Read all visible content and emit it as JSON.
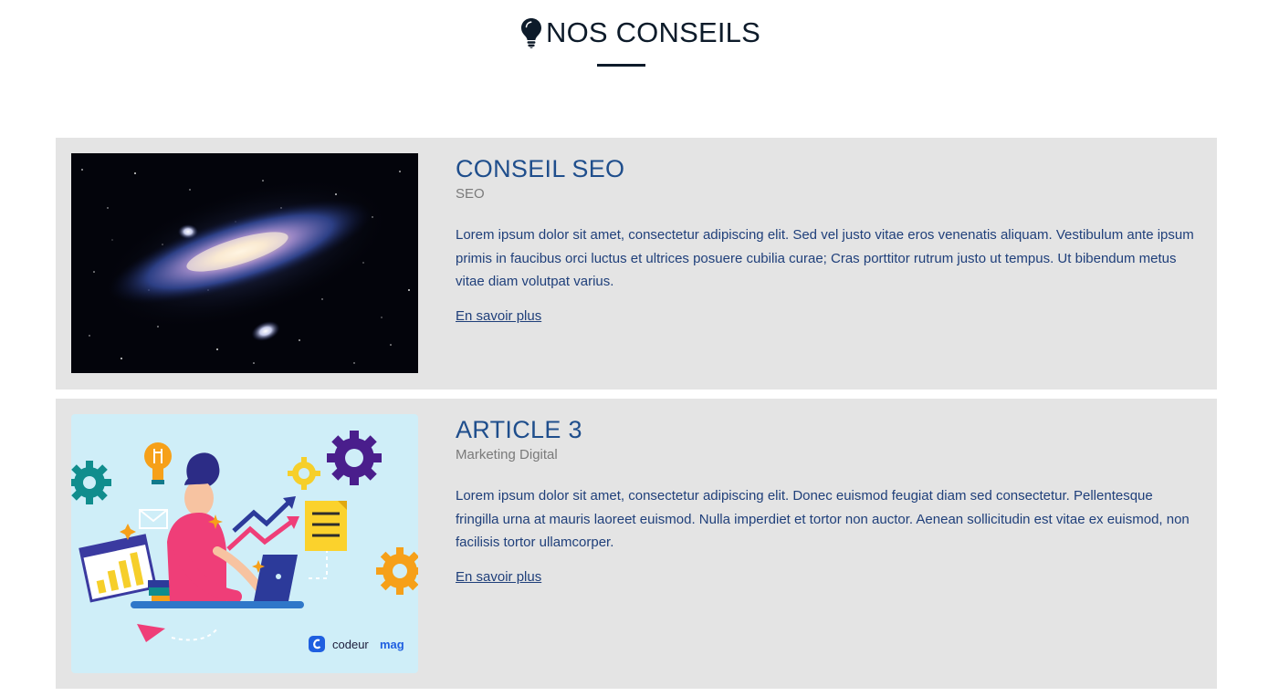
{
  "section": {
    "title": "NOS CONSEILS",
    "icon": "lightbulb-icon"
  },
  "articles": [
    {
      "title": "CONSEIL SEO",
      "category": "SEO",
      "excerpt": "Lorem ipsum dolor sit amet, consectetur adipiscing elit. Sed vel justo vitae eros venenatis aliquam. Vestibulum ante ipsum primis in faucibus orci luctus et ultrices posuere cubilia curae; Cras porttitor rutrum justo ut tempus. Ut bibendum metus vitae diam volutpat varius.",
      "link_label": "En savoir plus",
      "image": "galaxy-image"
    },
    {
      "title": "ARTICLE 3",
      "category": "Marketing Digital",
      "excerpt": "Lorem ipsum dolor sit amet, consectetur adipiscing elit. Donec euismod feugiat diam sed consectetur. Pellentesque fringilla urna at mauris laoreet euismod. Nulla imperdiet et tortor non auctor. Aenean sollicitudin est vitae ex euismod, non facilisis tortor ullamcorper.",
      "link_label": "En savoir plus",
      "image": "digital-marketing-illustration",
      "image_brand": "codeur mag"
    }
  ],
  "colors": {
    "card_background": "#e4e4e4",
    "title_blue": "#1f4e8c",
    "text_blue": "#1f3f7a",
    "category_gray": "#7a7a7a",
    "heading_dark": "#0d1b2a"
  }
}
